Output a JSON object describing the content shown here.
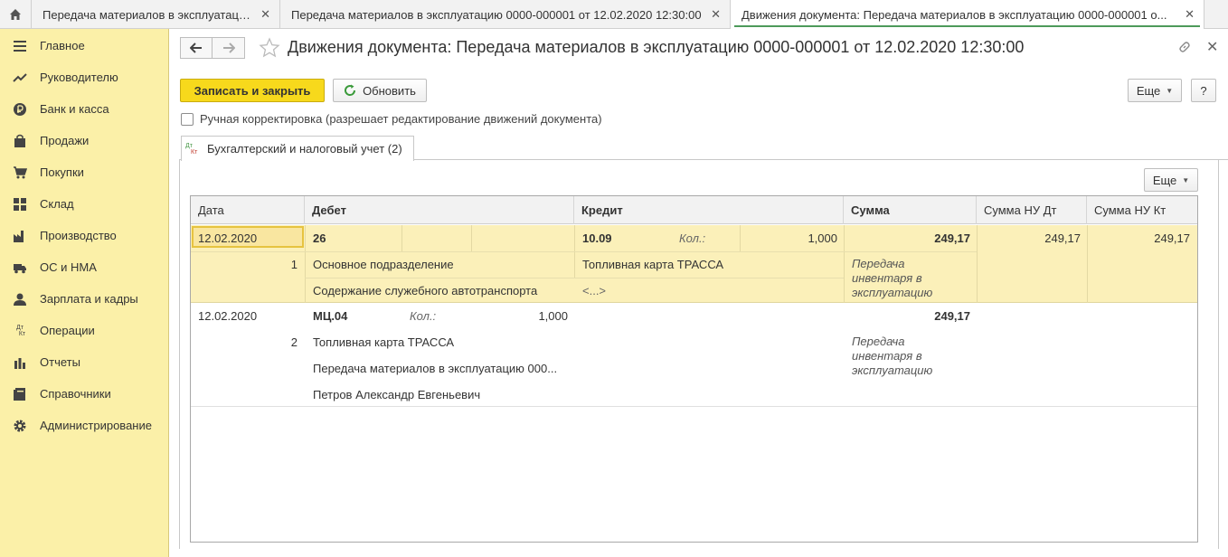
{
  "tabs": [
    {
      "label": "Передача материалов в эксплуатацию",
      "active": false
    },
    {
      "label": "Передача материалов в эксплуатацию 0000-000001 от 12.02.2020 12:30:00",
      "active": false
    },
    {
      "label": "Движения документа: Передача материалов в эксплуатацию 0000-000001 о...",
      "active": true
    }
  ],
  "sidebar": {
    "items": [
      {
        "label": "Главное",
        "icon": "menu-icon"
      },
      {
        "label": "Руководителю",
        "icon": "trend-icon"
      },
      {
        "label": "Банк и касса",
        "icon": "ruble-icon"
      },
      {
        "label": "Продажи",
        "icon": "bag-icon"
      },
      {
        "label": "Покупки",
        "icon": "cart-icon"
      },
      {
        "label": "Склад",
        "icon": "warehouse-icon"
      },
      {
        "label": "Производство",
        "icon": "factory-icon"
      },
      {
        "label": "ОС и НМА",
        "icon": "truck-icon"
      },
      {
        "label": "Зарплата и кадры",
        "icon": "person-icon"
      },
      {
        "label": "Операции",
        "icon": "dt-kt-icon"
      },
      {
        "label": "Отчеты",
        "icon": "bar-chart-icon"
      },
      {
        "label": "Справочники",
        "icon": "book-icon"
      },
      {
        "label": "Администрирование",
        "icon": "gear-icon"
      }
    ]
  },
  "header": {
    "title": "Движения документа: Передача материалов в эксплуатацию 0000-000001 от 12.02.2020 12:30:00"
  },
  "toolbar": {
    "save_close": "Записать и закрыть",
    "refresh": "Обновить",
    "more": "Еще",
    "help": "?"
  },
  "manual_correction": "Ручная корректировка (разрешает редактирование движений документа)",
  "doc_tab": {
    "label": "Бухгалтерский и налоговый учет (2)",
    "icon_dt": "Дт",
    "icon_kt": "Кт"
  },
  "table": {
    "more": "Еще",
    "columns": [
      "Дата",
      "Дебет",
      "Кредит",
      "Сумма",
      "Сумма НУ Дт",
      "Сумма НУ Кт"
    ],
    "rows": [
      {
        "date": "12.02.2020",
        "num": "1",
        "debit_account": "26",
        "debit_sub1": "Основное подразделение",
        "debit_sub2": "Содержание служебного автотранспорта",
        "credit_account": "10.09",
        "qty_label": "Кол.:",
        "qty": "1,000",
        "credit_sub1": "Топливная карта ТРАССА",
        "credit_sub2": "<...>",
        "sum": "249,17",
        "comment": "Передача инвентаря в эксплуатацию",
        "sum_nu_dt": "249,17",
        "sum_nu_kt": "249,17"
      },
      {
        "date": "12.02.2020",
        "num": "2",
        "debit_account": "МЦ.04",
        "qty_label": "Кол.:",
        "qty": "1,000",
        "debit_sub1": "Топливная карта ТРАССА",
        "debit_sub2": "Передача материалов в эксплуатацию 000...",
        "debit_sub3": "Петров Александр Евгеньевич",
        "sum": "249,17",
        "comment": "Передача инвентаря в эксплуатацию"
      }
    ]
  },
  "colors": {
    "accent_yellow": "#f7d91c",
    "sidebar_bg": "#fbf0a8",
    "selected_row": "#fbf0b9",
    "active_tab_line": "#4d9a5a"
  }
}
